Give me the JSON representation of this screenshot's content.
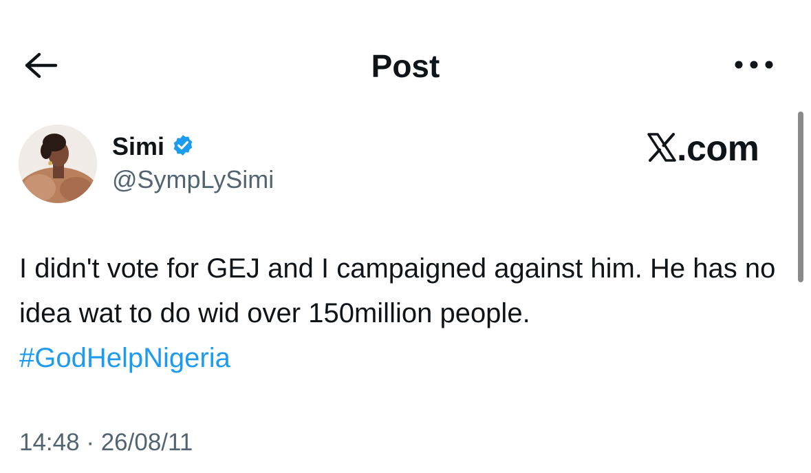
{
  "header": {
    "title": "Post",
    "back_icon": "arrow-left-icon",
    "more_icon": "more-horizontal-icon"
  },
  "author": {
    "display_name": "Simi",
    "handle": "@SympLySimi",
    "verified": true,
    "verified_color": "#1d9bf0",
    "avatar_icon": "avatar-photo"
  },
  "watermark": {
    "brand": ".com",
    "logo_icon": "x-logo-icon"
  },
  "tweet": {
    "text": "I didn't vote for GEJ and I campaigned against him. He has no idea wat to do wid over 150million people.",
    "hashtag": "#GodHelpNigeria",
    "hashtag_color": "#1d9bf0"
  },
  "meta": {
    "time": "14:48",
    "separator": "·",
    "date": "26/08/11"
  }
}
